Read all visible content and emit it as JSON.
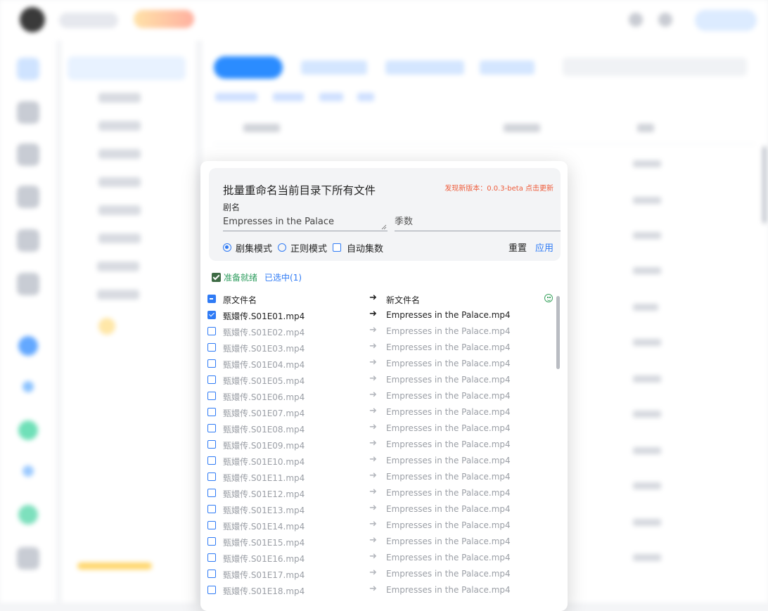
{
  "dialog": {
    "title": "批量重命名当前目录下所有文件",
    "update_notice": "发现新版本：0.0.3-beta 点击更新",
    "drama_label": "剧名",
    "drama_value": "Empresses in the Palace",
    "season_placeholder": "季数",
    "modes": [
      {
        "label": "剧集模式",
        "selected": true
      },
      {
        "label": "正则模式",
        "selected": false
      }
    ],
    "auto_episode_label": "自动集数",
    "reset_label": "重置",
    "apply_label": "应用",
    "ready_label": "准备就绪",
    "selected_label": "已选中(1)",
    "header": {
      "original": "原文件名",
      "new": "新文件名"
    },
    "files": [
      {
        "original": "甄嬛传.S01E01.mp4",
        "new": "Empresses in the Palace.mp4",
        "checked": true
      },
      {
        "original": "甄嬛传.S01E02.mp4",
        "new": "Empresses in the Palace.mp4",
        "checked": false
      },
      {
        "original": "甄嬛传.S01E03.mp4",
        "new": "Empresses in the Palace.mp4",
        "checked": false
      },
      {
        "original": "甄嬛传.S01E04.mp4",
        "new": "Empresses in the Palace.mp4",
        "checked": false
      },
      {
        "original": "甄嬛传.S01E05.mp4",
        "new": "Empresses in the Palace.mp4",
        "checked": false
      },
      {
        "original": "甄嬛传.S01E06.mp4",
        "new": "Empresses in the Palace.mp4",
        "checked": false
      },
      {
        "original": "甄嬛传.S01E07.mp4",
        "new": "Empresses in the Palace.mp4",
        "checked": false
      },
      {
        "original": "甄嬛传.S01E08.mp4",
        "new": "Empresses in the Palace.mp4",
        "checked": false
      },
      {
        "original": "甄嬛传.S01E09.mp4",
        "new": "Empresses in the Palace.mp4",
        "checked": false
      },
      {
        "original": "甄嬛传.S01E10.mp4",
        "new": "Empresses in the Palace.mp4",
        "checked": false
      },
      {
        "original": "甄嬛传.S01E11.mp4",
        "new": "Empresses in the Palace.mp4",
        "checked": false
      },
      {
        "original": "甄嬛传.S01E12.mp4",
        "new": "Empresses in the Palace.mp4",
        "checked": false
      },
      {
        "original": "甄嬛传.S01E13.mp4",
        "new": "Empresses in the Palace.mp4",
        "checked": false
      },
      {
        "original": "甄嬛传.S01E14.mp4",
        "new": "Empresses in the Palace.mp4",
        "checked": false
      },
      {
        "original": "甄嬛传.S01E15.mp4",
        "new": "Empresses in the Palace.mp4",
        "checked": false
      },
      {
        "original": "甄嬛传.S01E16.mp4",
        "new": "Empresses in the Palace.mp4",
        "checked": false
      },
      {
        "original": "甄嬛传.S01E17.mp4",
        "new": "Empresses in the Palace.mp4",
        "checked": false
      },
      {
        "original": "甄嬛传.S01E18.mp4",
        "new": "Empresses in the Palace.mp4",
        "checked": false
      }
    ]
  },
  "colors": {
    "accent": "#2f7bf5",
    "update_notice": "#ee5b3a",
    "ready_green": "#2f9d5f",
    "dim_text": "#9b9fa6"
  },
  "icons": {
    "arrow": "arrow-right-icon",
    "status": "smiley-icon"
  }
}
